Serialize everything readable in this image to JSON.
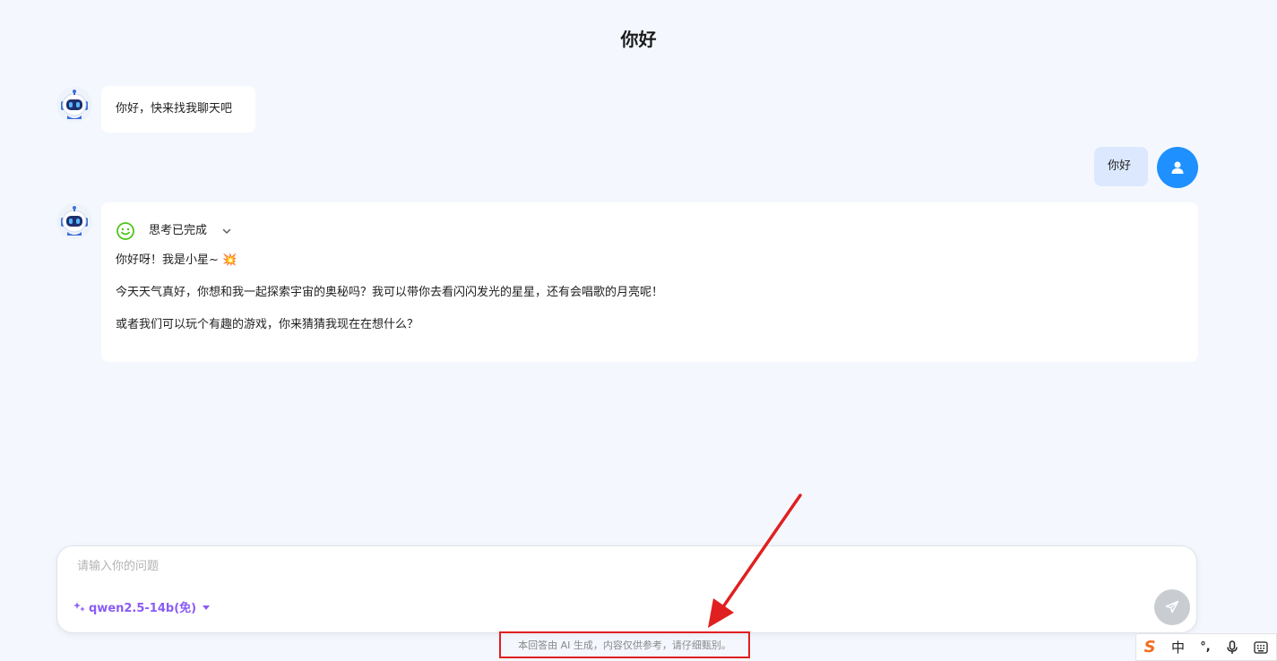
{
  "header": {
    "title": "你好"
  },
  "messages": [
    {
      "role": "assistant",
      "text": "你好，快来找我聊天吧"
    },
    {
      "role": "user",
      "text": "你好"
    },
    {
      "role": "assistant",
      "thinking_status": "思考已完成",
      "paragraphs": [
        "你好呀！我是小星~ 💥",
        "今天天气真好，你想和我一起探索宇宙的奥秘吗？我可以带你去看闪闪发光的星星，还有会唱歌的月亮呢！",
        "或者我们可以玩个有趣的游戏，你来猜猜我现在在想什么？"
      ]
    }
  ],
  "composer": {
    "placeholder": "请输入你的问题",
    "value": "",
    "model": "qwen2.5-14b(免)"
  },
  "footer": {
    "disclaimer": "本回答由 AI 生成，内容仅供参考，请仔细甄别。"
  },
  "ime": {
    "logo": "S",
    "mode": "中",
    "punct": "°,"
  },
  "colors": {
    "background": "#f4f8fe",
    "user_bubble": "#dbe8fd",
    "user_avatar": "#1e90ff",
    "model_accent": "#8a5cf6",
    "highlight_box": "#e02020",
    "think_icon": "#52c41a",
    "ime_logo": "#f26c20"
  }
}
